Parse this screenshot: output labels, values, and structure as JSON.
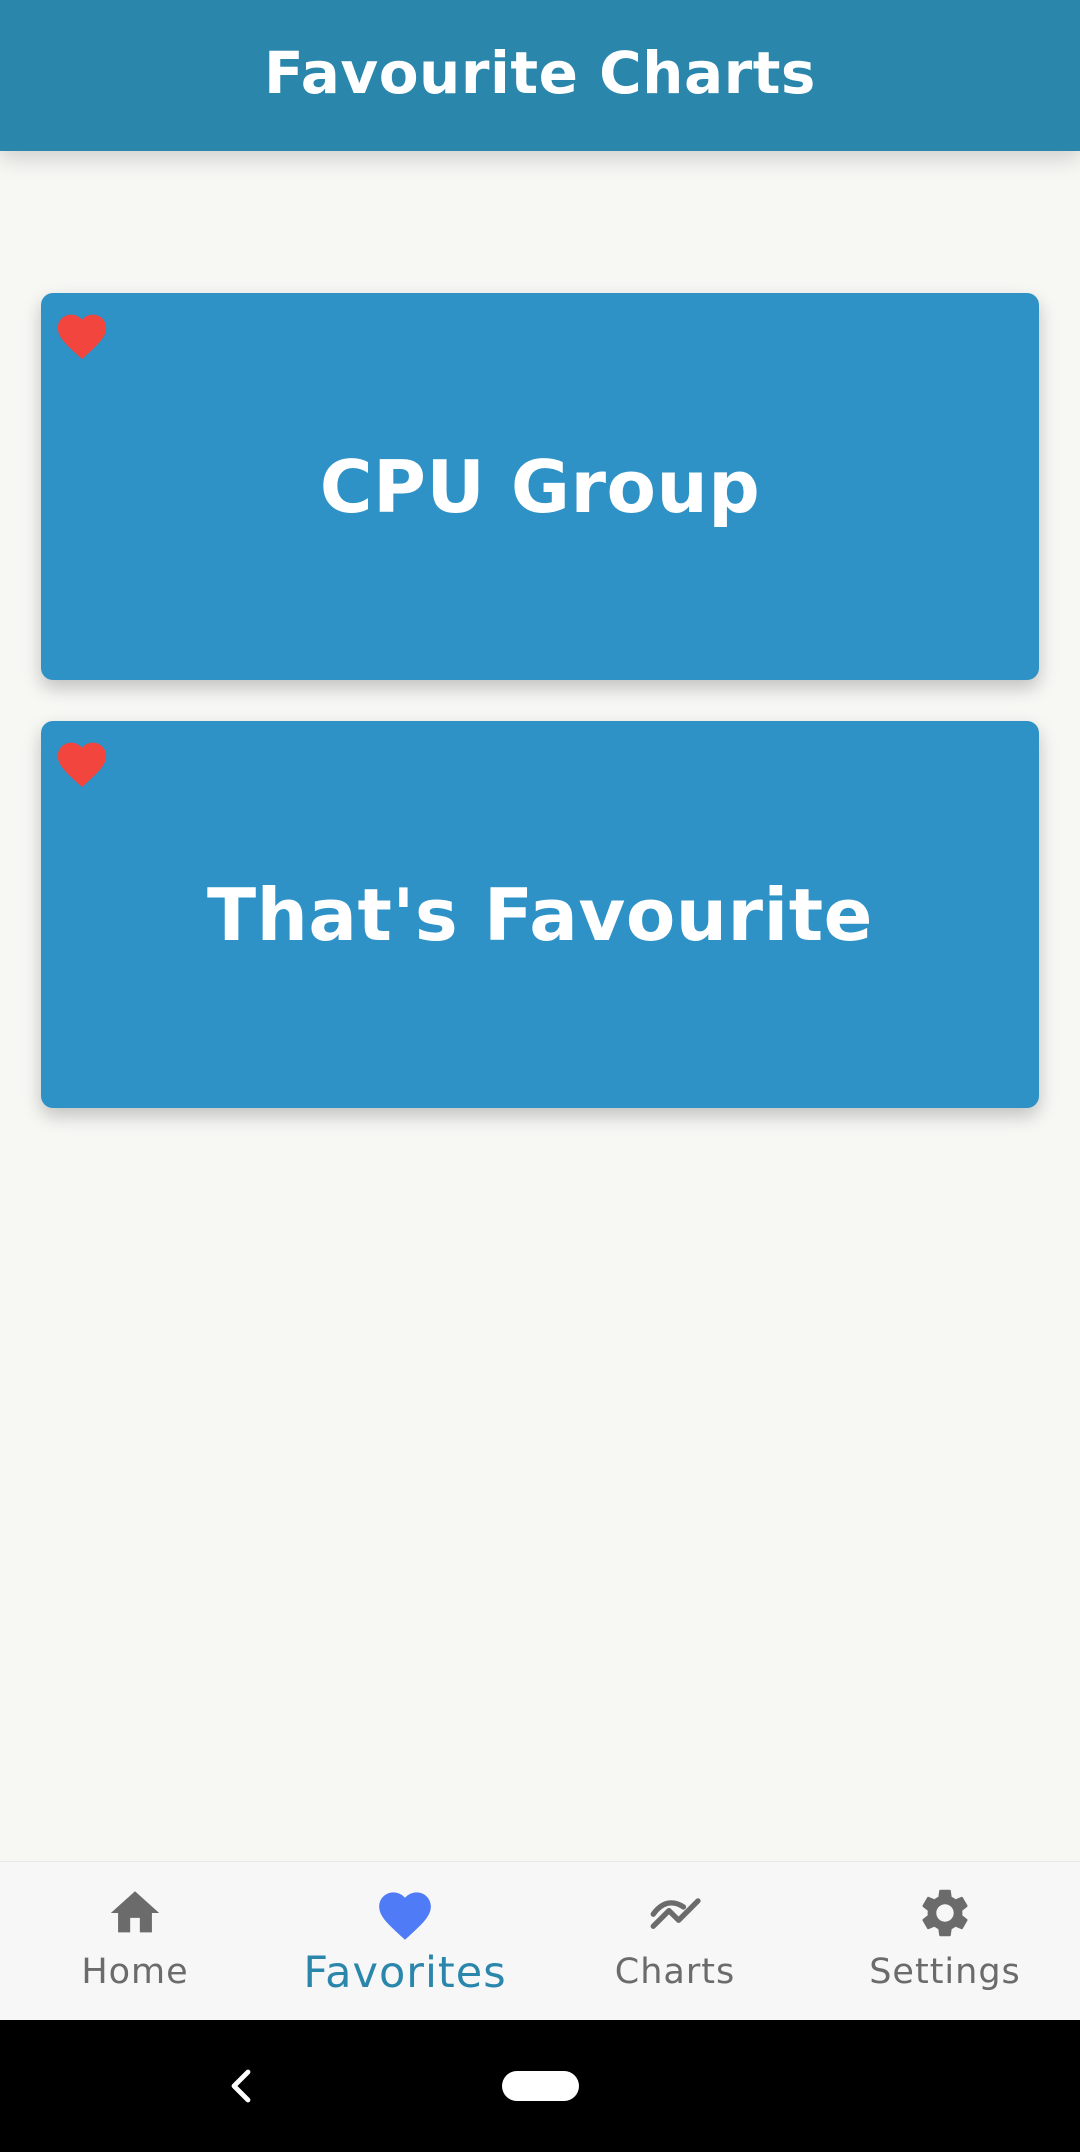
{
  "app_bar": {
    "title": "Favourite Charts"
  },
  "favorites": [
    {
      "title": "CPU Group",
      "icon": "heart-icon",
      "favorited": true
    },
    {
      "title": "That's Favourite",
      "icon": "heart-icon",
      "favorited": true
    }
  ],
  "bottom_nav": {
    "active_index": 1,
    "items": [
      {
        "label": "Home",
        "icon": "home-icon"
      },
      {
        "label": "Favorites",
        "icon": "heart-icon"
      },
      {
        "label": "Charts",
        "icon": "chart-line-icon"
      },
      {
        "label": "Settings",
        "icon": "gear-icon"
      }
    ]
  },
  "system_nav": {
    "back_icon": "back-chevron-icon",
    "home_icon": "home-pill-icon"
  },
  "colors": {
    "app_bar": "#2b86ac",
    "card": "#2e92c7",
    "heart": "#f1453d",
    "nav_active_icon": "#4f7bf7",
    "nav_active_label": "#2b86ac",
    "nav_inactive": "#6b6b6b",
    "background": "#f7f7f4"
  }
}
